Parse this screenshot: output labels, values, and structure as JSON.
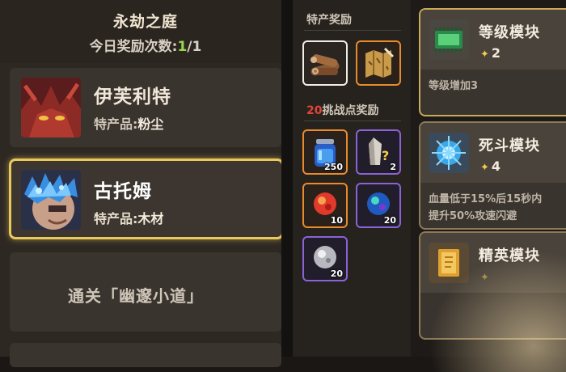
{
  "left_panel": {
    "title": "永劫之庭",
    "daily_label": "今日奖励次数:",
    "daily_current": "1",
    "daily_sep": "/",
    "daily_total": "1",
    "bosses": [
      {
        "name": "伊芙利特",
        "product_label": "特产品:",
        "product_value": "粉尘",
        "selected": false
      },
      {
        "name": "古托姆",
        "product_label": "特产品:",
        "product_value": "木材",
        "selected": true
      }
    ],
    "clear_stage": "通关「幽邃小道」"
  },
  "rewards": {
    "special_title": "特产奖励",
    "special_items": [
      {
        "icon": "wood-logs-icon",
        "rarity": "white"
      },
      {
        "icon": "map-scroll-icon",
        "rarity": "orange"
      }
    ],
    "challenge_count": "20",
    "challenge_title": "挑战点奖励",
    "challenge_items": [
      {
        "icon": "blue-potion-jar-icon",
        "rarity": "orange",
        "count": "250"
      },
      {
        "icon": "mystery-crystal-icon",
        "rarity": "purple",
        "count": "2"
      },
      {
        "icon": "red-gem-orb-icon",
        "rarity": "orange",
        "count": "10"
      },
      {
        "icon": "blue-gem-orb-icon",
        "rarity": "purple",
        "count": "20"
      },
      {
        "icon": "white-gem-orb-icon",
        "rarity": "purple",
        "count": "20"
      }
    ]
  },
  "modules": [
    {
      "name": "等级模块",
      "level": "2",
      "icon": "green-chip-icon",
      "desc": "等级增加3"
    },
    {
      "name": "死斗模块",
      "level": "4",
      "icon": "ice-burst-icon",
      "desc": "血量低于15%后15秒内\n提升50%攻速闪避"
    },
    {
      "name": "精英模块",
      "level": "",
      "icon": "gold-card-icon",
      "desc": ""
    }
  ],
  "colors": {
    "selected_border": "#e9c95b",
    "challenge_number": "#e0443a",
    "daily_highlight": "#9bd64a",
    "rarity_orange": "#e98a2c",
    "rarity_purple": "#8a64d6",
    "rarity_white": "#f1ede6"
  }
}
